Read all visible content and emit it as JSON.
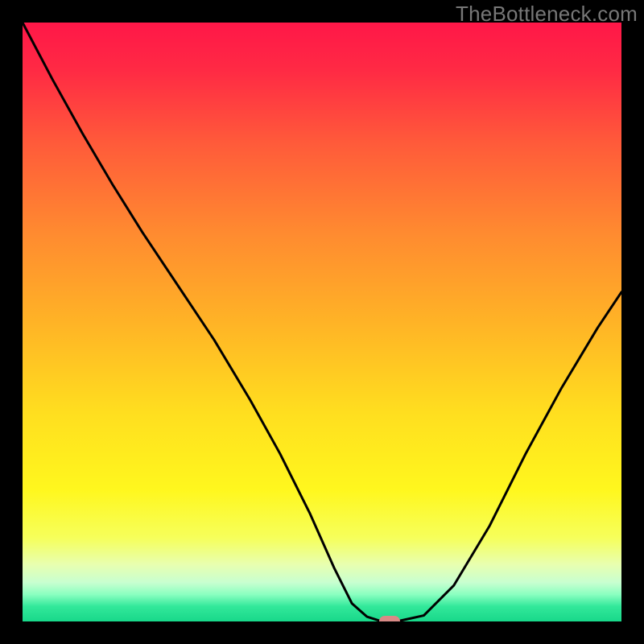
{
  "watermark": "TheBottleneck.com",
  "chart_data": {
    "type": "line",
    "title": "",
    "xlabel": "",
    "ylabel": "",
    "xlim": [
      0,
      1
    ],
    "ylim": [
      0,
      1
    ],
    "grid": false,
    "legend": false,
    "background_gradient": [
      {
        "pos": 0.0,
        "color": "#ff1748"
      },
      {
        "pos": 0.08,
        "color": "#ff2a44"
      },
      {
        "pos": 0.2,
        "color": "#ff5a3a"
      },
      {
        "pos": 0.35,
        "color": "#ff8a30"
      },
      {
        "pos": 0.5,
        "color": "#ffb326"
      },
      {
        "pos": 0.65,
        "color": "#ffde1f"
      },
      {
        "pos": 0.78,
        "color": "#fff71e"
      },
      {
        "pos": 0.86,
        "color": "#f6ff5a"
      },
      {
        "pos": 0.905,
        "color": "#e8ffb0"
      },
      {
        "pos": 0.935,
        "color": "#c8ffd0"
      },
      {
        "pos": 0.955,
        "color": "#8affc0"
      },
      {
        "pos": 0.975,
        "color": "#32e89a"
      },
      {
        "pos": 1.0,
        "color": "#18d88a"
      }
    ],
    "series": [
      {
        "name": "bottleneck-curve",
        "color": "#000000",
        "stroke_width": 3,
        "x": [
          0.0,
          0.05,
          0.1,
          0.15,
          0.2,
          0.26,
          0.32,
          0.38,
          0.43,
          0.48,
          0.52,
          0.55,
          0.575,
          0.6,
          0.625,
          0.67,
          0.72,
          0.78,
          0.84,
          0.9,
          0.96,
          1.0
        ],
        "y": [
          1.0,
          0.905,
          0.815,
          0.73,
          0.65,
          0.56,
          0.47,
          0.37,
          0.28,
          0.18,
          0.09,
          0.03,
          0.008,
          0.0,
          0.0,
          0.01,
          0.06,
          0.16,
          0.28,
          0.39,
          0.49,
          0.55
        ]
      }
    ],
    "marker": {
      "x": 0.613,
      "y": 0.0,
      "width_frac": 0.035,
      "height_frac": 0.02,
      "color": "#d98a86"
    }
  }
}
